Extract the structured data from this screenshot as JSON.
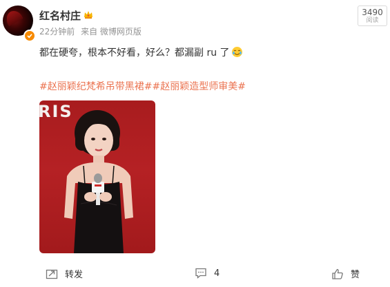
{
  "post": {
    "user_name": "红名村庄",
    "meta": {
      "time": "22分钟前",
      "source": "来自 微博网页版"
    },
    "read_count": {
      "value": "3490",
      "label": "阅读"
    },
    "text": "都在硬夸，根本不好看，好么？都漏副 ru 了",
    "emoji_icon": "tear-smile-emoji-icon",
    "topics": "#赵丽颖纪梵希吊带黑裙##赵丽颖造型师审美#",
    "image": {
      "overlay_text": "RIS"
    }
  },
  "actions": {
    "repost_label": "转发",
    "comment_count": "4",
    "like_label": "赞"
  },
  "colors": {
    "topic_link": "#eb7350",
    "verified_badge": "#f78a00",
    "meta_gray": "#939393",
    "image_background": "#b52124"
  }
}
